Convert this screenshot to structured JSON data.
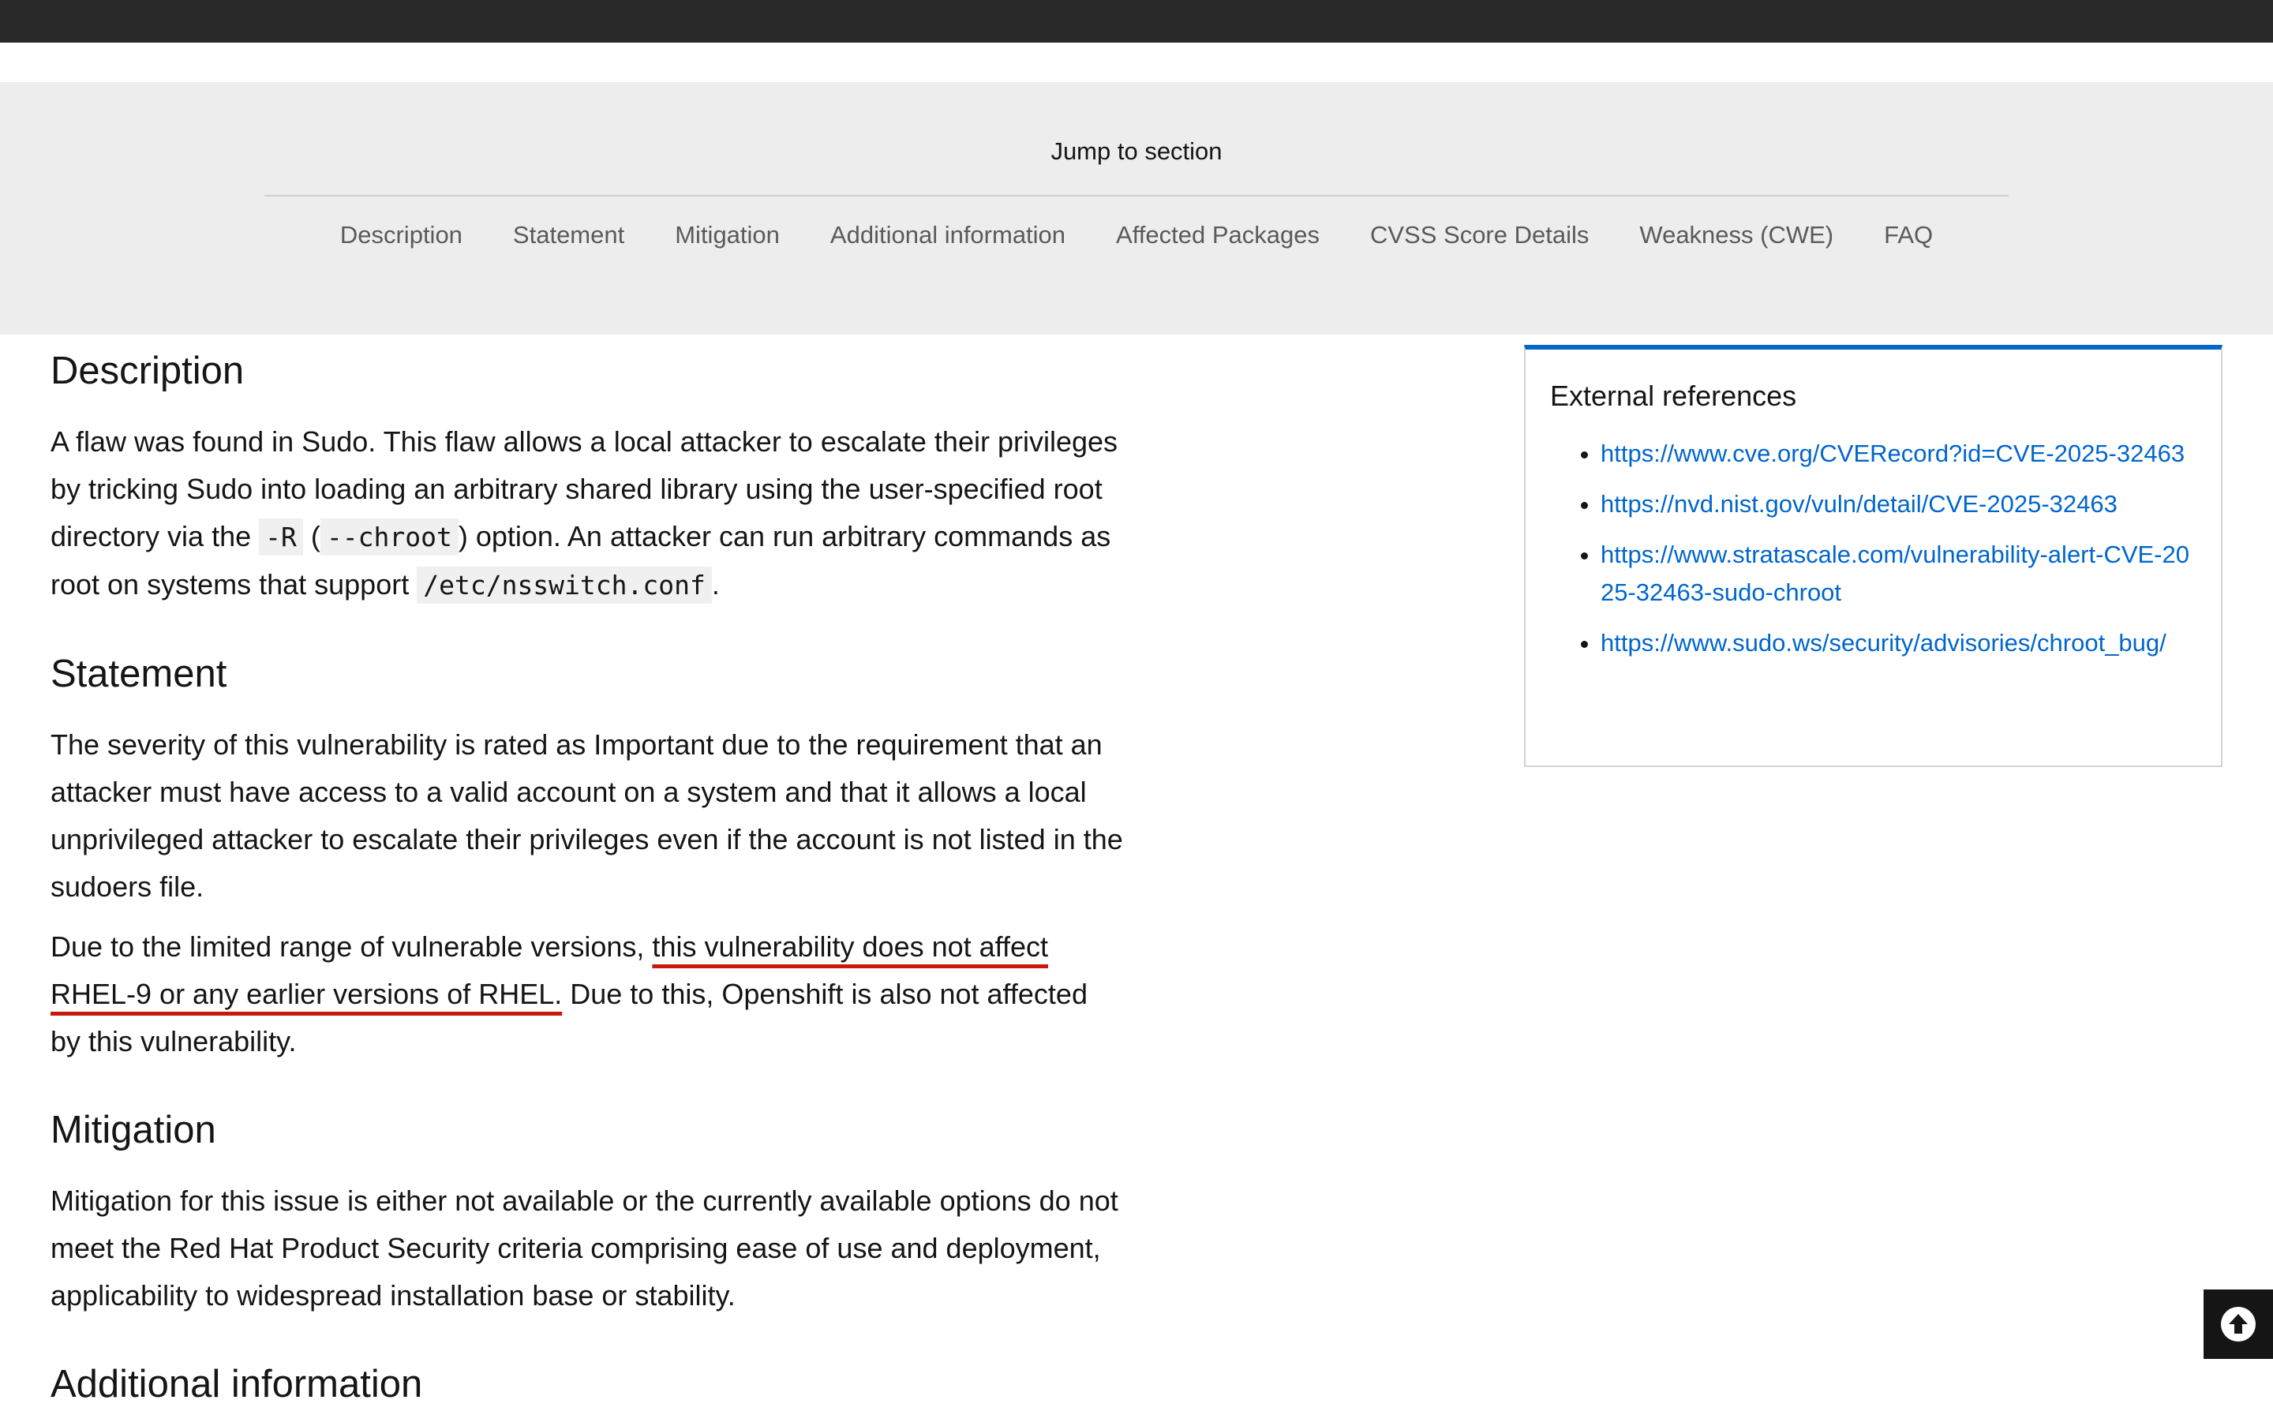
{
  "jump": {
    "title": "Jump to section",
    "nav": [
      "Description",
      "Statement",
      "Mitigation",
      "Additional information",
      "Affected Packages",
      "CVSS Score Details",
      "Weakness (CWE)",
      "FAQ"
    ]
  },
  "description": {
    "heading": "Description",
    "text_1": "A flaw was found in Sudo. This flaw allows a local attacker to escalate their privileges by tricking Sudo into loading an arbitrary shared library using the user-specified root directory via the ",
    "code_1": "-R",
    "text_2": " (",
    "code_2": "--chroot",
    "text_3": ") option. An attacker can run arbitrary commands as root on systems that support ",
    "code_3": "/etc/nsswitch.conf",
    "text_4": "."
  },
  "statement": {
    "heading": "Statement",
    "para_1": "The severity of this vulnerability is rated as Important due to the requirement that an attacker must have access to a valid account on a system and that it allows a local unprivileged attacker to escalate their privileges even if the account is not listed in the sudoers file.",
    "para_2_pre": "Due to the limited range of vulnerable versions, ",
    "para_2_underlined": "this vulnerability does not affect RHEL-9 or any earlier versions of RHEL.",
    "para_2_post": " Due to this, Openshift is also not affected by this vulnerability."
  },
  "mitigation": {
    "heading": "Mitigation",
    "text": "Mitigation for this issue is either not available or the currently available options do not meet the Red Hat Product Security criteria comprising ease of use and deployment, applicability to widespread installation base or stability."
  },
  "additional": {
    "heading": "Additional information"
  },
  "external_references": {
    "title": "External references",
    "links": [
      "https://www.cve.org/CVERecord?id=CVE-2025-32463",
      "https://nvd.nist.gov/vuln/detail/CVE-2025-32463",
      "https://www.stratascale.com/vulnerability-alert-CVE-2025-32463-sudo-chroot",
      "https://www.sudo.ws/security/advisories/chroot_bug/"
    ]
  },
  "colors": {
    "link": "#0066cc",
    "highlight_underline": "#c9190b",
    "card_accent": "#0066cc"
  },
  "icons": {
    "back_to_top": "circle-arrow-up-icon"
  }
}
